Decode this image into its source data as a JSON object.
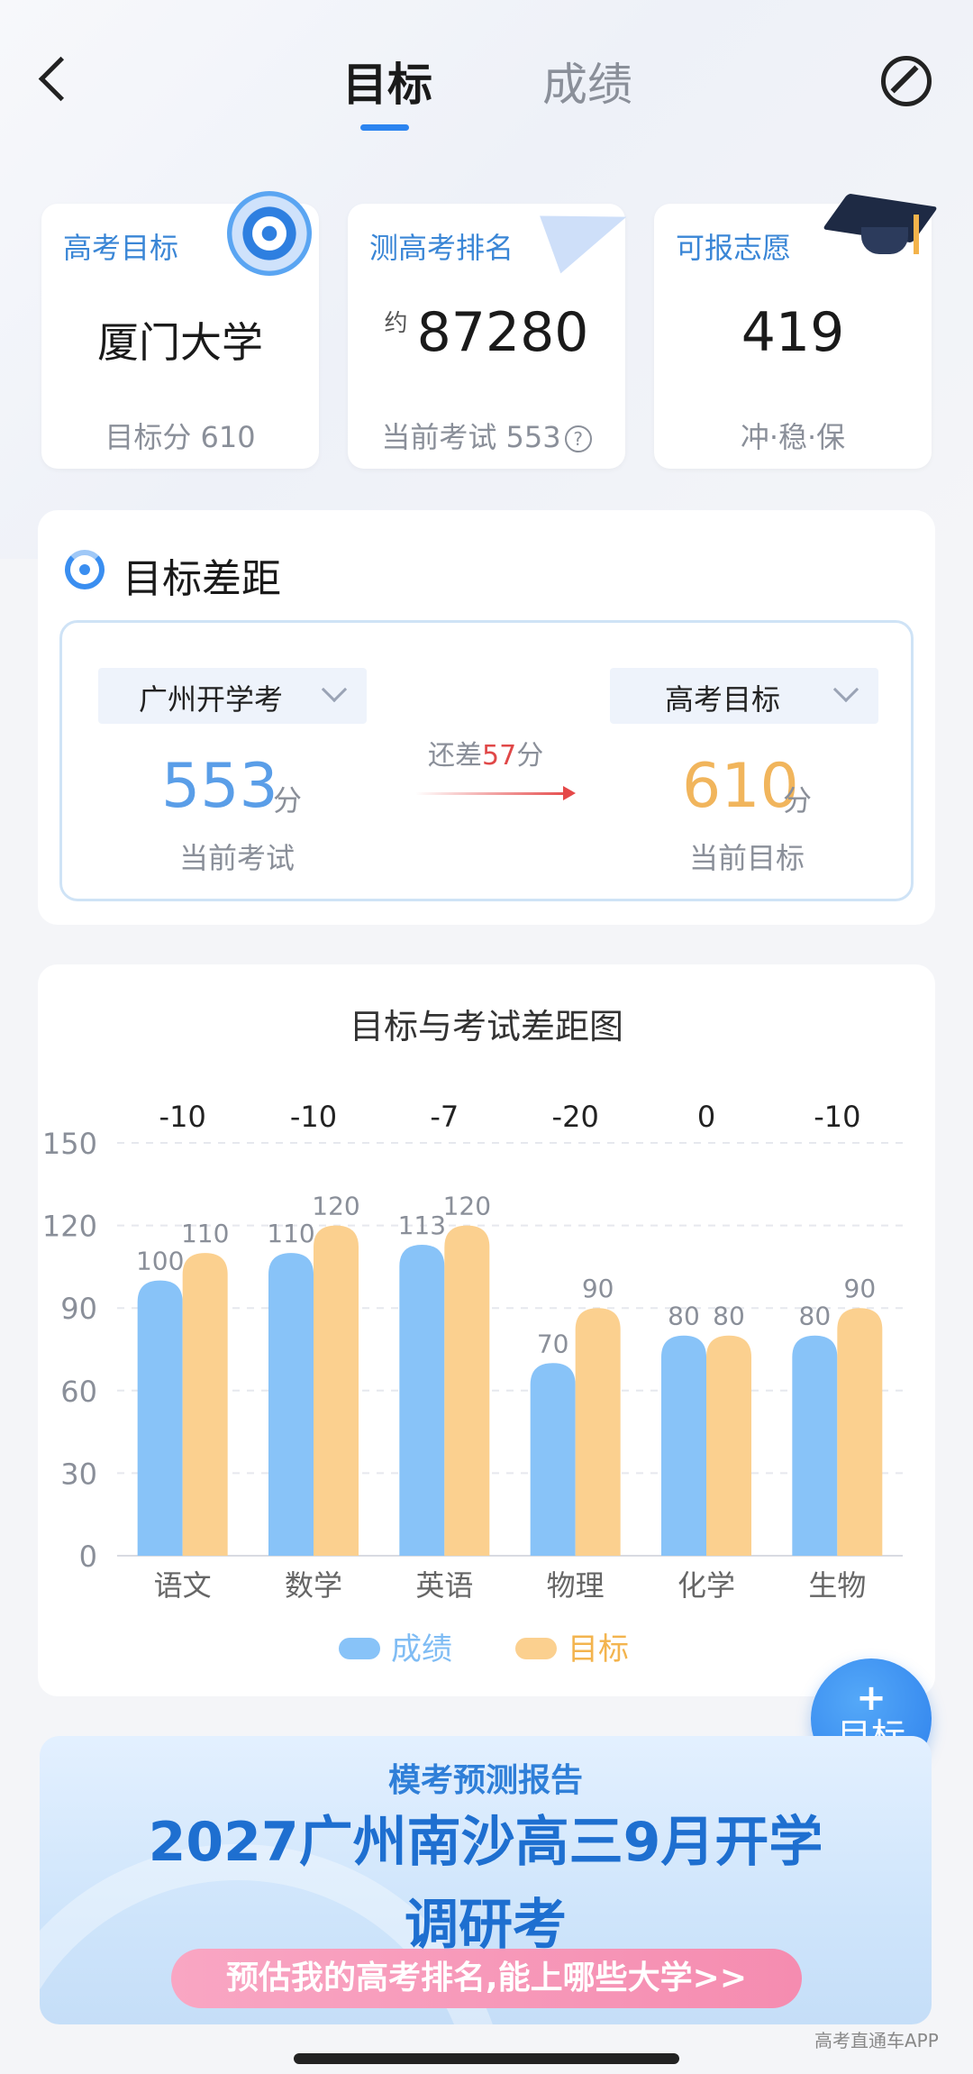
{
  "header": {
    "tabs": [
      {
        "label": "目标",
        "active": true
      },
      {
        "label": "成绩",
        "active": false
      }
    ],
    "accent_color": "#2b84f0"
  },
  "stats": {
    "target": {
      "label": "高考目标",
      "value": "厦门大学",
      "sub": "目标分 610"
    },
    "rank": {
      "label": "测高考排名",
      "prefix": "约",
      "value": "87280",
      "sub": "当前考试 553",
      "help": "?"
    },
    "volunteer": {
      "label": "可报志愿",
      "value": "419",
      "sub": "冲·稳·保"
    }
  },
  "gap": {
    "title": "目标差距",
    "left_select": "广州开学考",
    "right_select": "高考目标",
    "diff_prefix": "还差",
    "diff_value": "57",
    "diff_suffix": "分",
    "current_score": "553",
    "current_unit": "分",
    "current_caption": "当前考试",
    "target_score": "610",
    "target_unit": "分",
    "target_caption": "当前目标"
  },
  "chart_data": {
    "type": "bar",
    "title": "目标与考试差距图",
    "categories": [
      "语文",
      "数学",
      "英语",
      "物理",
      "化学",
      "生物"
    ],
    "series": [
      {
        "name": "成绩",
        "values": [
          100,
          110,
          113,
          70,
          80,
          80
        ],
        "color": "#88c3f8"
      },
      {
        "name": "目标",
        "values": [
          110,
          120,
          120,
          90,
          80,
          90
        ],
        "color": "#fbd08f"
      }
    ],
    "differences": [
      "-10",
      "-10",
      "-7",
      "-20",
      "0",
      "-10"
    ],
    "ylim": [
      0,
      150
    ],
    "yticks": [
      0,
      30,
      60,
      90,
      120,
      150
    ],
    "grid": true,
    "legend": "bottom"
  },
  "fab": {
    "plus": "+",
    "label": "目标"
  },
  "banner": {
    "subtitle": "模考预测报告",
    "title_line1": "2027广州南沙高三9月开学",
    "title_line2": "调研考",
    "cta": "预估我的高考排名,能上哪些大学>>"
  },
  "watermark": "高考直通车APP"
}
